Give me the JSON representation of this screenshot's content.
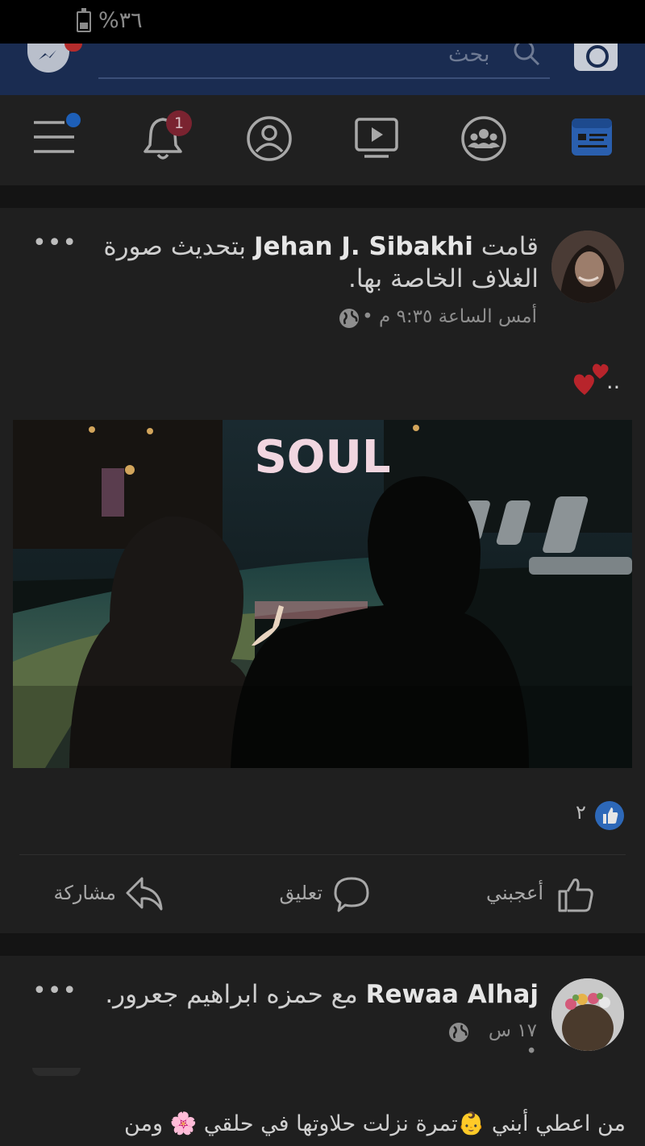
{
  "status_bar": {
    "battery_percent": "%٣٦"
  },
  "top_bar": {
    "search_placeholder": "بحث"
  },
  "nav": {
    "notification_count": "1",
    "tabs": [
      "news-feed",
      "groups",
      "watch",
      "profile",
      "notifications",
      "menu"
    ]
  },
  "posts": [
    {
      "prefix": "قامت",
      "author": "Jehan J. Sibakhi",
      "action_text": "بتحديث صورة الغلاف الخاصة بها.",
      "timestamp": "أمس الساعة ٩:٣٥ م •",
      "body": "..",
      "image_text": "SOUL",
      "like_count": "٢",
      "actions": {
        "like": "أعجبني",
        "comment": "تعليق",
        "share": "مشاركة"
      }
    },
    {
      "author": "Rewaa Alhaj",
      "with_text": "مع حمزه ابراهيم جعرور.",
      "timestamp": "١٧ س •",
      "body": "من اعطي أبني 👶تمرة نزلت حلاوتها في حلقي 🌸 ومن"
    }
  ],
  "colors": {
    "brand_blue": "#1a2c51",
    "like_blue": "#2d68b8",
    "badge_red": "#7a2330"
  }
}
